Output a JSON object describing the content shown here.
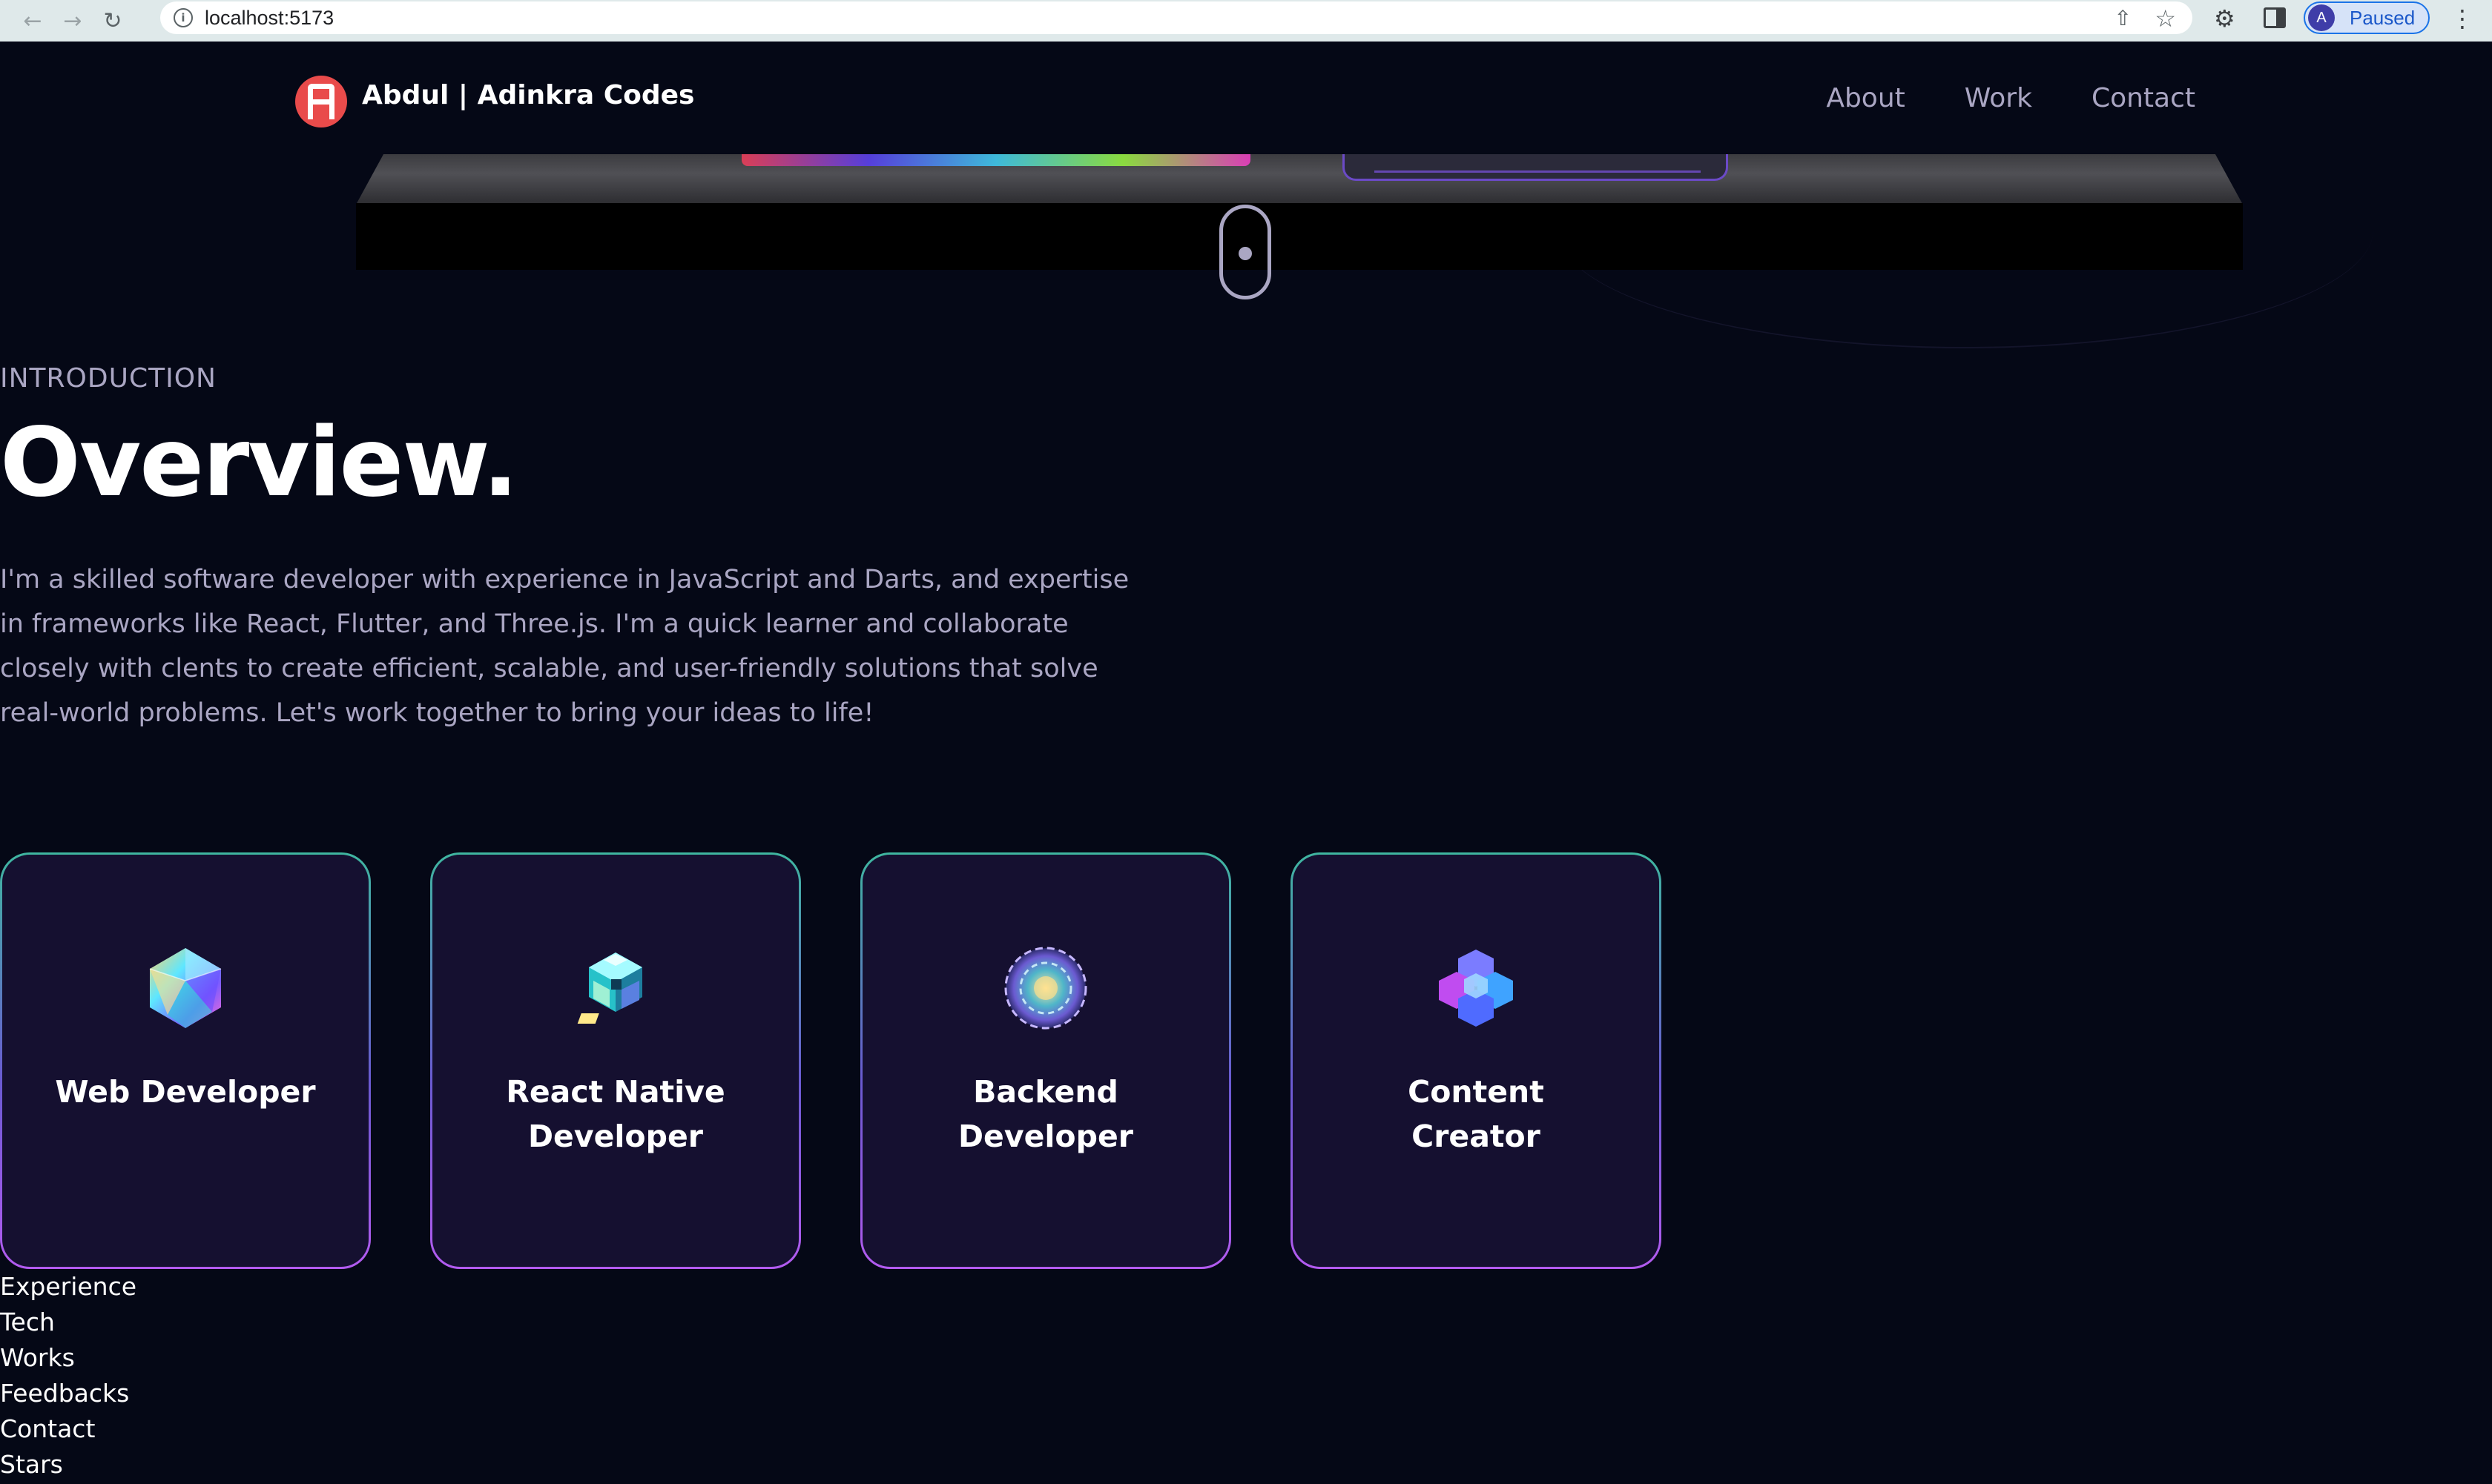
{
  "browser": {
    "url": "localhost:5173",
    "profile_initial": "A",
    "profile_status": "Paused"
  },
  "navbar": {
    "brand": "Abdul | Adinkra Codes",
    "links": [
      "About",
      "Work",
      "Contact"
    ]
  },
  "overview": {
    "subtitle": "INTRODUCTION",
    "heading": "Overview.",
    "text": "I'm a skilled software developer with experience in JavaScript and Darts, and expertise in frameworks like React, Flutter, and Three.js. I'm a quick learner and collaborate closely with clents to create efficient, scalable, and user-friendly solutions that solve real-world problems. Let's work together to bring your ideas to life!"
  },
  "services": [
    {
      "title": "Web Developer",
      "icon": "icosahedron-icon"
    },
    {
      "title": "React Native Developer",
      "icon": "cube-cluster-icon"
    },
    {
      "title": "Backend Developer",
      "icon": "geodesic-sphere-icon"
    },
    {
      "title": "Content Creator",
      "icon": "hexagon-flower-icon"
    }
  ],
  "sections": [
    "Experience",
    "Tech",
    "Works",
    "Feedbacks",
    "Contact",
    "Stars"
  ],
  "colors": {
    "background": "#050816",
    "secondary_text": "#aaa6c3",
    "card_bg": "#151030",
    "logo": "#e94b4b"
  }
}
